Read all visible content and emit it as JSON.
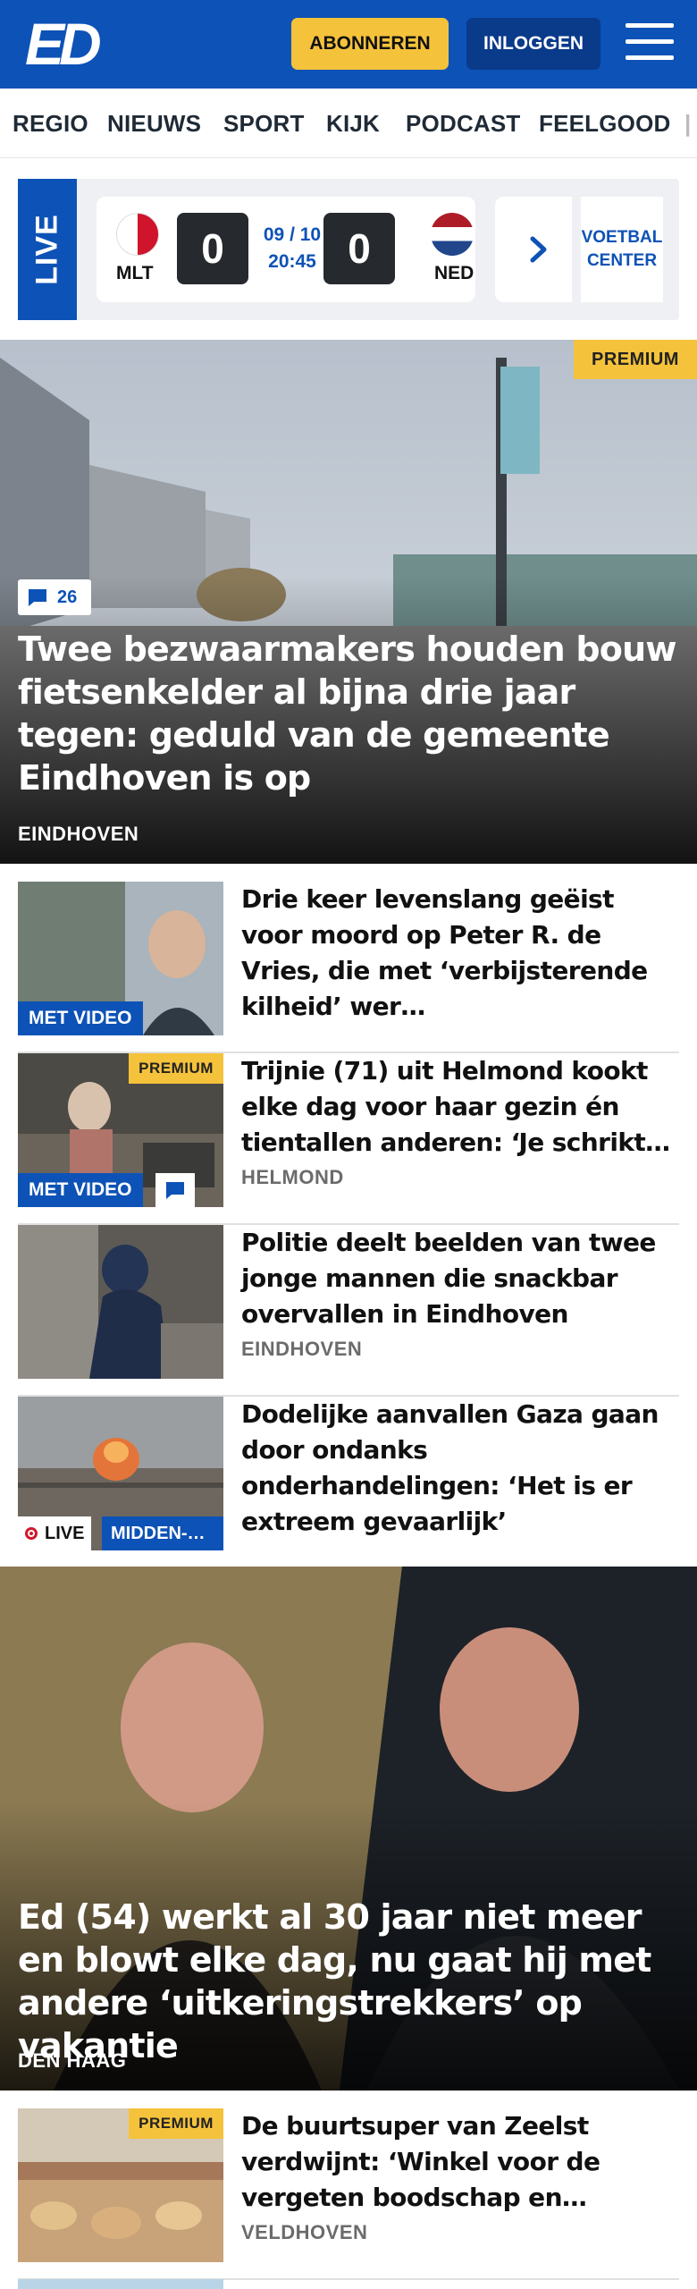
{
  "header": {
    "logo": "ED",
    "subscribe_label": "ABONNEREN",
    "login_label": "INLOGGEN",
    "colors": {
      "brand": "#0d52b6",
      "accent": "#f5c23b"
    }
  },
  "nav": {
    "items": [
      "REGIO",
      "NIEUWS",
      "SPORT",
      "KIJK",
      "PODCAST",
      "FEELGOOD"
    ]
  },
  "live": {
    "label": "LIVE",
    "match": {
      "home_team": "MLT",
      "home_score": "0",
      "away_team": "NED",
      "away_score": "0",
      "date": "09 / 10",
      "time": "20:45"
    },
    "voetbal_center_line1": "VOETBAL",
    "voetbal_center_line2": "CENTER"
  },
  "hero": {
    "badge": "PREMIUM",
    "comments": "26",
    "title": "Twee bezwaarmakers houden bouw fietsenkelder al bijna drie jaar tegen: geduld van de gemeente Eindhoven is op",
    "location": "EINDHOVEN"
  },
  "articles": [
    {
      "title": "Drie keer levenslang geëist voor moord op Peter R. de Vries, die met ‘verbijsterende kilheid’ wer…",
      "video_label": "MET VIDEO",
      "location": ""
    },
    {
      "badge": "PREMIUM",
      "title": "Trijnie (71) uit Helmond kookt elke dag voor haar gezin én tientallen anderen: ‘Je schrikt…",
      "video_label": "MET VIDEO",
      "location": "HELMOND"
    },
    {
      "title": "Politie deelt beelden van twee jonge mannen die snackbar overvallen in Eindhoven",
      "location": "EINDHOVEN"
    },
    {
      "title": "Dodelijke aanvallen Gaza gaan door ondanks onderhandelingen: ‘Het is er extreem gevaarlijk’",
      "live_label": "LIVE",
      "region_label": "MIDDEN-…"
    }
  ],
  "hero2": {
    "title": "Ed (54) werkt al 30 jaar niet meer en blowt elke dag, nu gaat hij met andere ‘uitkeringstrekkers’ op vakantie",
    "location": "DEN HAAG"
  },
  "article5": {
    "badge": "PREMIUM",
    "title": "De buurtsuper van Zeelst verdwijnt: ‘Winkel voor de vergeten boodschap en…",
    "location": "VELDHOVEN"
  }
}
